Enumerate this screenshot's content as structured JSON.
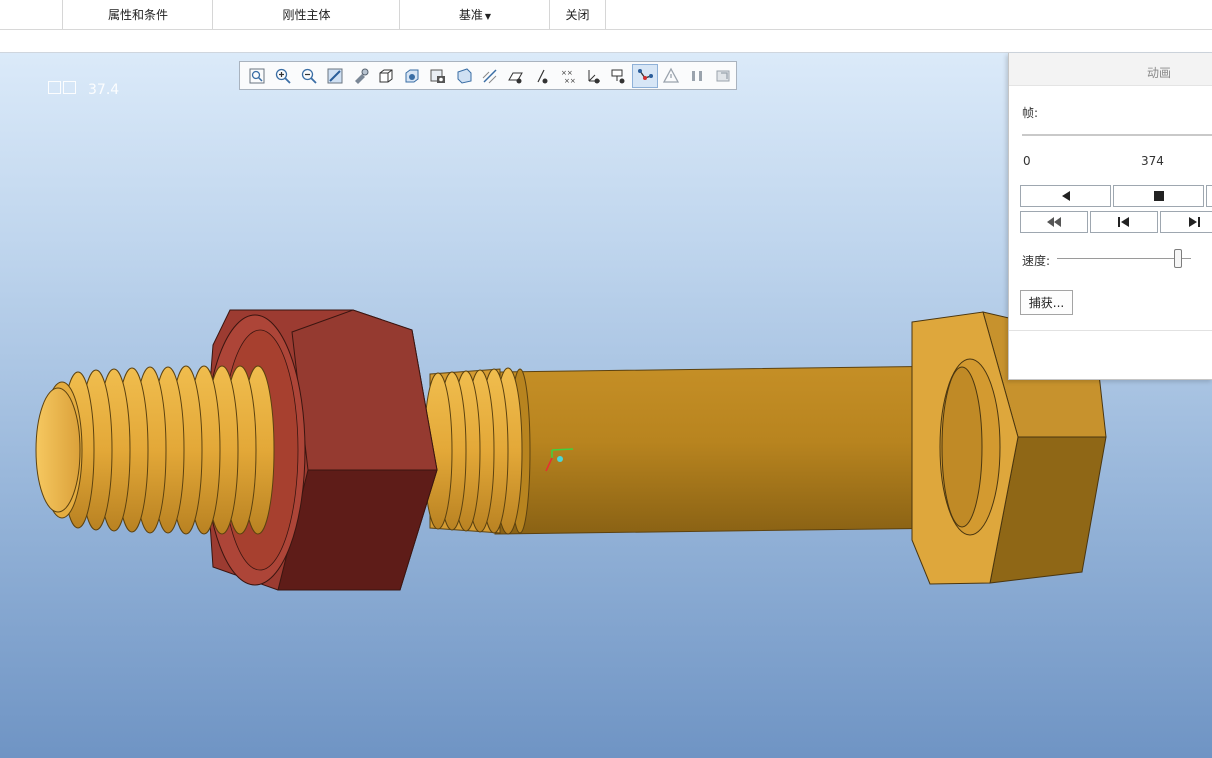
{
  "ribbon": {
    "tabs": [
      "属性和条件",
      "刚性主体",
      "基准",
      "关闭"
    ]
  },
  "viewport": {
    "frame_readout": "37.4",
    "background_top": "#dbeaf9",
    "background_bottom": "#6f94c4",
    "colors": {
      "bolt": "#d9a230",
      "nut": "#9a3a30"
    }
  },
  "toolbar": {
    "icons": [
      "refit-icon",
      "zoom-in-icon",
      "zoom-out-icon",
      "repaint-icon",
      "pan-zoom-icon",
      "display-style-icon",
      "saved-orientations-icon",
      "view-manager-icon",
      "perspective-icon",
      "datum-planes-icon",
      "datum-axes-icon",
      "datum-points-icon",
      "coordinate-systems-icon",
      "spin-center-icon",
      "annotation-display-icon",
      "connection-icon",
      "warning-icon",
      "pause-icon",
      "clear-icon"
    ],
    "active": "connection-icon"
  },
  "panel": {
    "title": "动画",
    "frame_label": "帧:",
    "frame_start": "0",
    "frame_end": "374",
    "speed_label": "速度:",
    "speed_level": 0.9,
    "capture_label": "捕获..."
  }
}
